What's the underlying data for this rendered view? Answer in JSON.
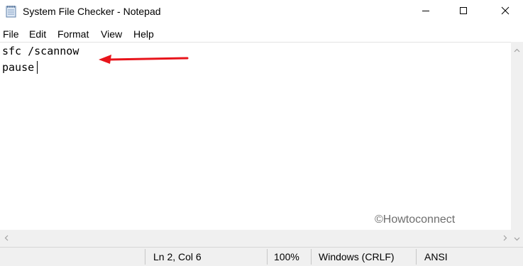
{
  "window": {
    "title": "System File Checker - Notepad",
    "icon": "notepad-icon",
    "controls": {
      "minimize": "minimize-icon",
      "maximize": "maximize-icon",
      "close": "close-icon"
    }
  },
  "menu": {
    "items": [
      {
        "label": "File"
      },
      {
        "label": "Edit"
      },
      {
        "label": "Format"
      },
      {
        "label": "View"
      },
      {
        "label": "Help"
      }
    ]
  },
  "editor": {
    "lines": [
      "sfc /scannow",
      "pause"
    ]
  },
  "annotation": {
    "arrow_color": "#e8141b",
    "points_to": "line-1"
  },
  "watermark": {
    "text": "©Howtoconnect"
  },
  "status": {
    "position": "Ln 2, Col 6",
    "zoom": "100%",
    "line_ending": "Windows (CRLF)",
    "encoding": "ANSI"
  },
  "colors": {
    "background": "#ffffff",
    "chrome": "#f0f0f0",
    "text": "#000000"
  }
}
